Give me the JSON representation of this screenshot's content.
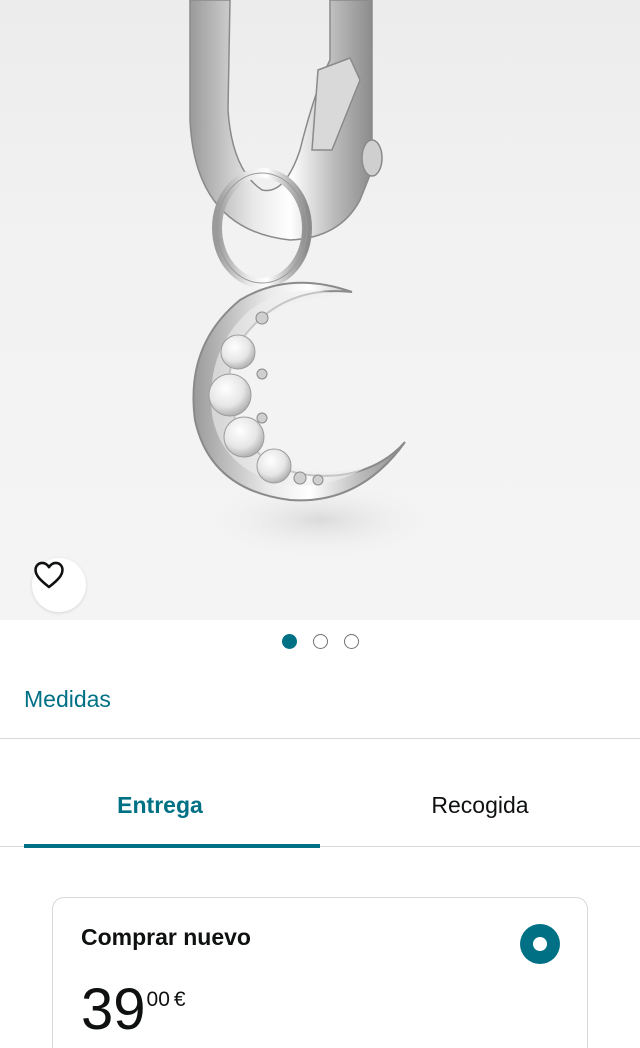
{
  "product_image": {
    "alt": "Colgante de luna plateado con circonitas"
  },
  "wishlist": {
    "icon": "heart-icon"
  },
  "carousel": {
    "count": 3,
    "active_index": 0
  },
  "measures_link": "Medidas",
  "tabs": [
    {
      "label": "Entrega",
      "active": true
    },
    {
      "label": "Recogida",
      "active": false
    }
  ],
  "buy_option": {
    "title": "Comprar nuevo",
    "selected": true,
    "price_whole": "39",
    "price_fraction": "00",
    "currency": "€"
  },
  "colors": {
    "accent": "#007185",
    "divider": "#d5d9d9",
    "text": "#0f1111"
  }
}
